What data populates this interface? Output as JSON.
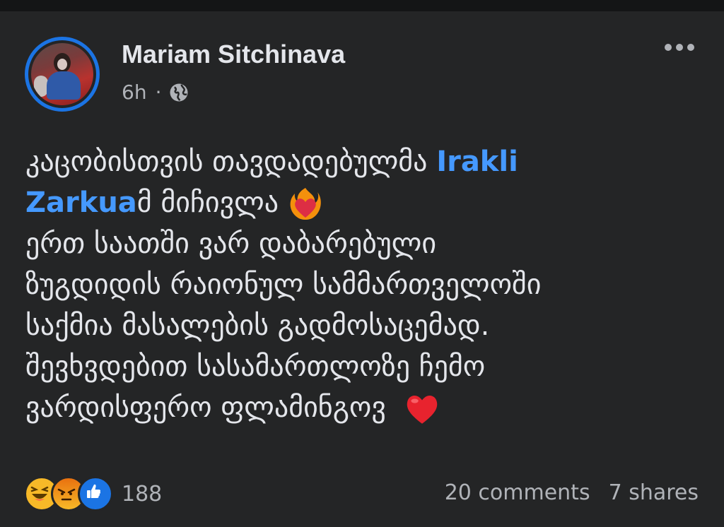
{
  "post": {
    "author": "Mariam Sitchinava",
    "time": "6h",
    "separator": "·",
    "audience_icon": "globe-icon",
    "more_icon": "more-options-icon"
  },
  "text": {
    "line1_prefix": "კაცობისთვის თავდადებულმა ",
    "mention_part1": "Irakli",
    "mention_part2": "Zarkua",
    "line2_suffix": "მ მიჩივლა",
    "line3": "ერთ საათში ვარ დაბარებული",
    "line4": "ზუგდიდის რაიონულ სამმართველოში",
    "line5": "საქმია მასალების გადმოსაცემად.",
    "line6": "შევხვდებით სასამართლოზე ჩემო",
    "line7": "ვარდისფერო ფლამინგოვ"
  },
  "footer": {
    "reaction_icons": [
      "haha-icon",
      "angry-icon",
      "like-icon"
    ],
    "reaction_count": "188",
    "comments": "20 comments",
    "shares": "7 shares"
  },
  "colors": {
    "background": "#242526",
    "text": "#e4e6eb",
    "secondary": "#b0b3b8",
    "mention": "#4599ff",
    "avatar_ring": "#1b74e4"
  }
}
